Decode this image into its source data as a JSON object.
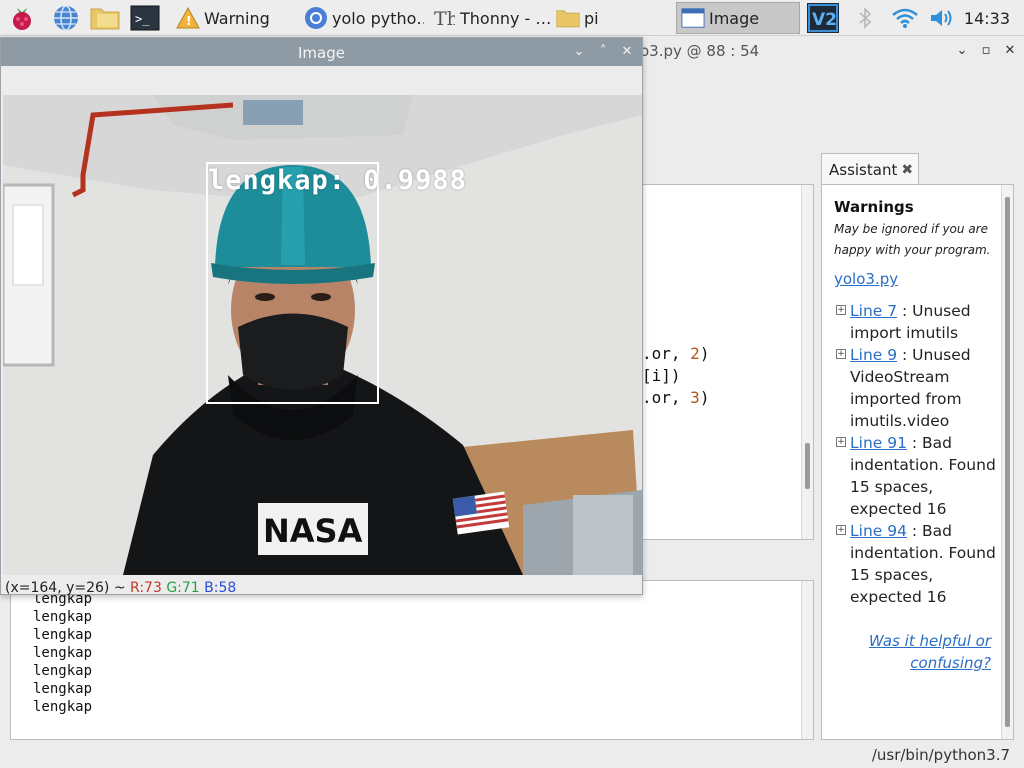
{
  "taskbar": {
    "tasks": [
      {
        "label": "Warning",
        "icon": "warning-icon"
      },
      {
        "label": "yolo pytho…",
        "icon": "chromium-icon"
      },
      {
        "label": "Thonny  -  …",
        "icon": "thonny-icon"
      },
      {
        "label": "pi",
        "icon": "folder-icon"
      },
      {
        "label": "Image",
        "icon": "window-icon"
      }
    ],
    "clock": "14:33"
  },
  "thonny": {
    "title_fragment": "o3.py  @  88 : 54",
    "code_lines": [
      {
        "text": ".or, ",
        "num": "2",
        "tail": ")"
      },
      {
        "text": "[i])",
        "num": "",
        "tail": ""
      },
      {
        "text": ".or, ",
        "num": "3",
        "tail": ")"
      }
    ],
    "shell_lines": [
      "lengkap",
      "lengkap",
      "lengkap",
      "lengkap",
      "lengkap",
      "lengkap",
      "lengkap"
    ],
    "status": "/usr/bin/python3.7"
  },
  "assistant": {
    "tab_label": "Assistant",
    "heading": "Warnings",
    "subtitle": "May be ignored if you are happy with your program.",
    "file_link": "yolo3.py",
    "warnings": [
      {
        "line": "Line 7",
        "text": " : Unused import imutils"
      },
      {
        "line": "Line 9",
        "text": " : Unused VideoStream imported from imutils.video"
      },
      {
        "line": "Line 91",
        "text": " : Bad indentation. Found 15 spaces, expected 16"
      },
      {
        "line": "Line 94",
        "text": " : Bad indentation. Found 15 spaces, expected 16"
      }
    ],
    "feedback": "Was it helpful or confusing?"
  },
  "image_window": {
    "title": "Image",
    "detection_label": "lengkap: 0.9988",
    "status": {
      "coords": "(x=164, y=26) ~ ",
      "r": "R:73",
      "g": "G:71",
      "b": "B:58"
    }
  }
}
